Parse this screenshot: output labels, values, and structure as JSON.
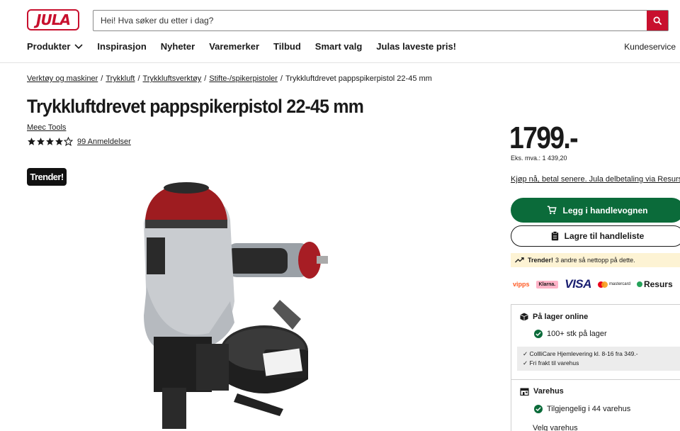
{
  "header": {
    "logo_text": "JULA",
    "search_placeholder": "Hei! Hva søker du etter i dag?",
    "nav": [
      {
        "label": "Produkter"
      },
      {
        "label": "Inspirasjon"
      },
      {
        "label": "Nyheter"
      },
      {
        "label": "Varemerker"
      },
      {
        "label": "Tilbud"
      },
      {
        "label": "Smart valg"
      },
      {
        "label": "Julas laveste pris!"
      }
    ],
    "customer_service": "Kundeservice"
  },
  "breadcrumb": [
    "Verktøy og maskiner",
    "Trykkluft",
    "Trykkluftsverktøy",
    "Stifte-/spikerpistoler",
    "Trykkluftdrevet pappspikerpistol 22-45 mm"
  ],
  "product": {
    "title": "Trykkluftdrevet pappspikerpistol 22-45 mm",
    "brand": "Meec Tools",
    "rating": 4,
    "rating_max": 5,
    "reviews": "99 Anmeldelser",
    "badge": "Trender!",
    "price": "1799.-",
    "price_ex_vat": "Eks. mva.: 1 439,20",
    "installment_link": "Kjøp nå, betal senere. Jula delbetaling via Resurs",
    "add_to_cart": "Legg i handlevognen",
    "save_to_list": "Lagre til handleliste",
    "trend_label": "Trender!",
    "trend_text": "3 andre så nettopp på dette."
  },
  "payments": {
    "vipps": "vipps",
    "klarna": "Klarna.",
    "visa": "VISA",
    "mastercard": "mastercard",
    "resurs": "Resurs"
  },
  "stock": {
    "online_title": "På lager online",
    "online_status": "100+ stk på lager",
    "delivery_lines": [
      "CollliCare Hjemlevering kl. 8-16 fra 349.-",
      "Fri frakt til varehus"
    ],
    "store_title": "Varehus",
    "store_status": "Tilgjengelig i 44 varehus",
    "choose_store": "Velg varehus"
  },
  "colors": {
    "brand_red": "#c8102e",
    "cart_green": "#0b6b3a",
    "trend_bg": "#fdf3d4"
  }
}
